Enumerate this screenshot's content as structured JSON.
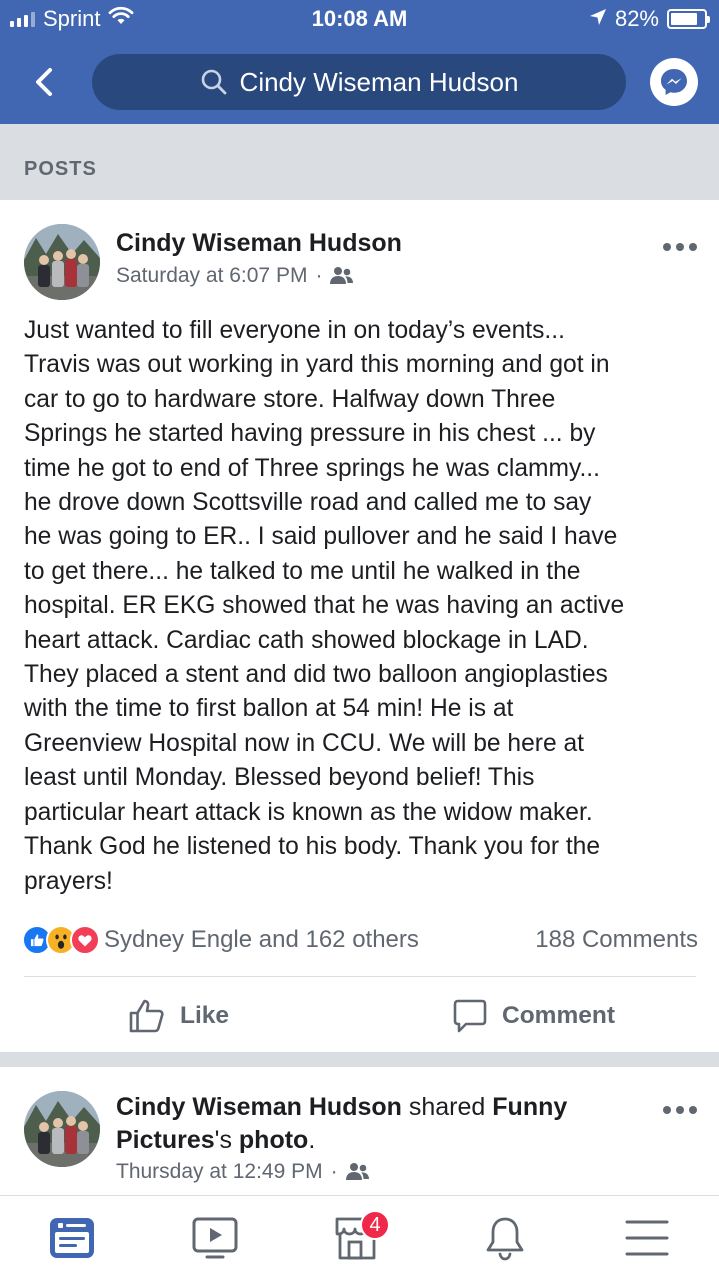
{
  "status_bar": {
    "carrier": "Sprint",
    "time": "10:08 AM",
    "battery": "82%",
    "battery_level": 0.82
  },
  "header": {
    "search_text": "Cindy Wiseman Hudson",
    "icons": [
      "back-icon",
      "search-icon",
      "messenger-icon"
    ]
  },
  "section": {
    "label": "POSTS"
  },
  "posts": [
    {
      "author": "Cindy Wiseman Hudson",
      "timestamp": "Saturday at 6:07 PM",
      "separator": "·",
      "privacy_icon": "friends-icon",
      "text": "Just wanted to fill everyone in on today’s events...\nTravis was out working in yard this morning and got in\ncar to go to hardware store. Halfway down Three\nSprings he started having pressure in his chest ... by\ntime he got to end of Three springs he was clammy...\nhe drove down Scottsville road and called me to say\nhe was going to ER.. I said pullover and he said I have\nto get there... he talked to me until he walked in the\nhospital. ER EKG showed that he was having an active\nheart attack. Cardiac cath showed blockage in LAD.\nThey placed a stent and did two balloon angioplasties\nwith the time to first ballon at 54 min! He is at\nGreenview Hospital now in CCU. We will be here at\nleast until Monday. Blessed beyond belief! This\nparticular heart attack is known as the widow maker.\nThank God he listened to his body. Thank you for the\nprayers!",
      "reactions_text": "Sydney Engle and 162 others",
      "reaction_icons": [
        "like-reaction-icon",
        "wow-reaction-icon",
        "love-reaction-icon"
      ],
      "comments_text": "188 Comments",
      "actions": {
        "like": "Like",
        "comment": "Comment"
      }
    },
    {
      "author": "Cindy Wiseman Hudson",
      "shared_text": "shared",
      "shared_page": "Funny Pictures",
      "shared_suffix": "'s",
      "shared_object": "photo",
      "shared_end": ".",
      "timestamp": "Thursday at 12:49 PM",
      "separator": "·",
      "privacy_icon": "friends-icon"
    }
  ],
  "tab_bar": {
    "tabs": [
      "news-feed-icon",
      "watch-icon",
      "marketplace-icon",
      "notifications-icon",
      "menu-icon"
    ],
    "marketplace_badge": "4",
    "active_color": "#4267b2",
    "inactive_color": "#606770"
  },
  "colors": {
    "brand_blue": "#4267b2",
    "search_bg": "#29487d",
    "badge_red": "#f02849"
  }
}
